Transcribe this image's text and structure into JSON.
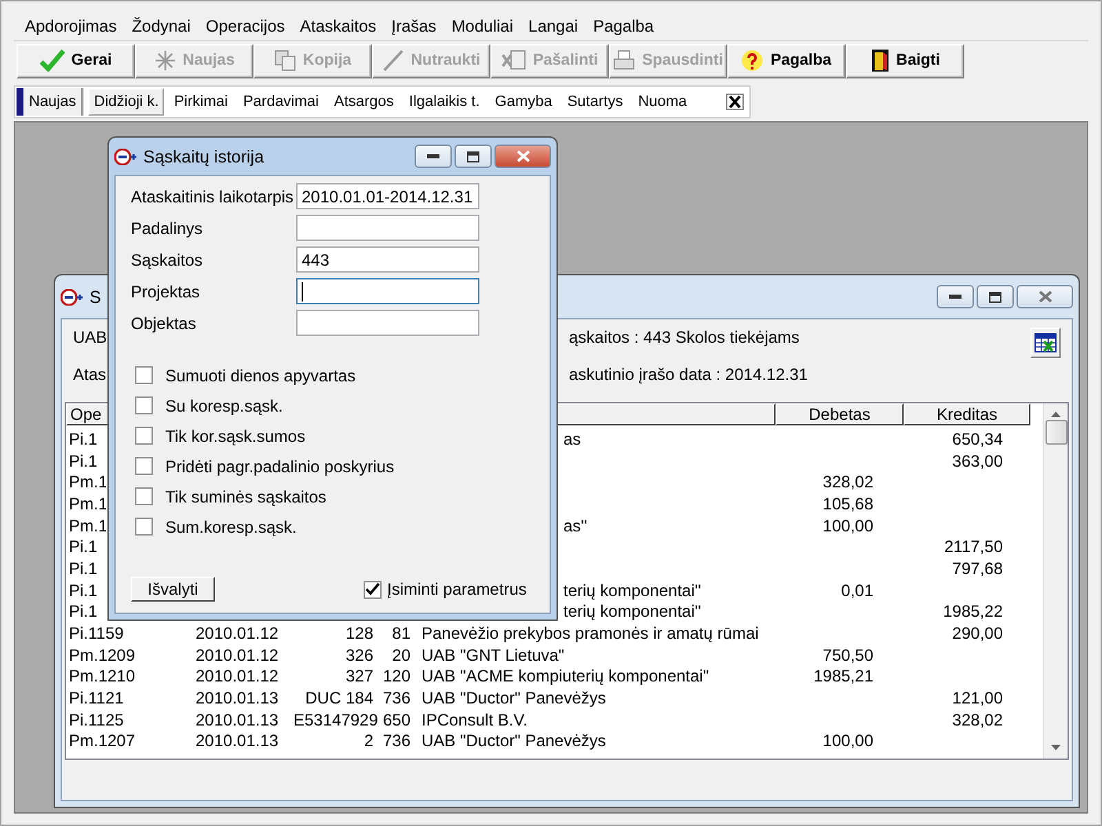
{
  "menu": [
    "Apdorojimas",
    "Žodynai",
    "Operacijos",
    "Ataskaitos",
    "Įrašas",
    "Moduliai",
    "Langai",
    "Pagalba"
  ],
  "toolbar": [
    {
      "label": "Gerai",
      "kind": "ok",
      "disabled": false
    },
    {
      "label": "Naujas",
      "kind": "new",
      "disabled": true
    },
    {
      "label": "Kopija",
      "kind": "copy",
      "disabled": true
    },
    {
      "label": "Nutraukti",
      "kind": "cancel",
      "disabled": true
    },
    {
      "label": "Pašalinti",
      "kind": "delete",
      "disabled": true
    },
    {
      "label": "Spausdinti",
      "kind": "print",
      "disabled": true
    },
    {
      "label": "Pagalba",
      "kind": "help",
      "disabled": false
    },
    {
      "label": "Baigti",
      "kind": "exit",
      "disabled": false
    }
  ],
  "tab_strip": {
    "lead": "Naujas",
    "tabs": [
      {
        "label": "Didžioji k.",
        "selected": true
      },
      {
        "label": "Pirkimai",
        "selected": false
      },
      {
        "label": "Pardavimai",
        "selected": false
      },
      {
        "label": "Atsargos",
        "selected": false
      },
      {
        "label": "Ilgalaikis t.",
        "selected": false
      },
      {
        "label": "Gamyba",
        "selected": false
      },
      {
        "label": "Sutartys",
        "selected": false
      },
      {
        "label": "Nuoma",
        "selected": false
      }
    ]
  },
  "back_window": {
    "title": "S",
    "info": [
      {
        "left": "UAB",
        "right": "ąskaitos : 443  Skolos tiekėjams"
      },
      {
        "left": "Atas",
        "right": "askutinio įrašo data : 2014.12.31"
      }
    ],
    "columns": [
      "Ope",
      "Debetas",
      "Kreditas"
    ],
    "rows": [
      {
        "kind": "partial",
        "op": "Pi.1",
        "name": "as",
        "credit": "650,34"
      },
      {
        "kind": "partial",
        "op": "Pi.1",
        "credit": "363,00"
      },
      {
        "kind": "partial",
        "op": "Pm.1",
        "debit": "328,02"
      },
      {
        "kind": "partial",
        "op": "Pm.1",
        "debit": "105,68"
      },
      {
        "kind": "partial",
        "op": "Pm.1",
        "name": "as''",
        "debit": "100,00"
      },
      {
        "kind": "partial",
        "op": "Pi.1",
        "credit": "2117,50"
      },
      {
        "kind": "partial",
        "op": "Pi.1",
        "credit": "797,68"
      },
      {
        "kind": "partial",
        "op": "Pi.1",
        "name": "terių komponentai''",
        "debit": "0,01"
      },
      {
        "kind": "partial",
        "op": "Pi.1",
        "name": "terių komponentai''",
        "credit": "1985,22"
      },
      {
        "kind": "full",
        "op": "Pi.1159",
        "date": "2010.01.12",
        "doc": "128",
        "code": "81",
        "name": "Panevėžio prekybos pramonės ir amatų rūmai",
        "credit": "290,00"
      },
      {
        "kind": "full",
        "op": "Pm.1209",
        "date": "2010.01.12",
        "doc": "326",
        "code": "20",
        "name": "UAB \"GNT Lietuva\"",
        "debit": "750,50"
      },
      {
        "kind": "full",
        "op": "Pm.1210",
        "date": "2010.01.12",
        "doc": "327",
        "code": "120",
        "name": "UAB \"ACME kompiuterių komponentai\"",
        "debit": "1985,21"
      },
      {
        "kind": "full",
        "op": "Pi.1121",
        "date": "2010.01.13",
        "doc": "DUC 184",
        "code": "736",
        "name": "UAB \"Ductor\" Panevėžys",
        "credit": "121,00"
      },
      {
        "kind": "full",
        "op": "Pi.1125",
        "date": "2010.01.13",
        "doc": "E53147929",
        "code": "650",
        "name": "IPConsult B.V.",
        "credit": "328,02"
      },
      {
        "kind": "full",
        "op": "Pm.1207",
        "date": "2010.01.13",
        "doc": "2",
        "code": "736",
        "name": "UAB \"Ductor\" Panevėžys",
        "debit": "100,00"
      }
    ]
  },
  "dialog": {
    "title": "Sąskaitų istorija",
    "fields": [
      {
        "label": "Ataskaitinis laikotarpis",
        "value": "2010.01.01-2014.12.31",
        "focused": false
      },
      {
        "label": "Padalinys",
        "focused": false
      },
      {
        "label": "Sąskaitos",
        "value": "443",
        "focused": false
      },
      {
        "label": "Projektas",
        "focused": true
      },
      {
        "label": "Objektas",
        "focused": false
      }
    ],
    "option_groups": [
      [
        {
          "label": "Sumuoti dienos apyvartas",
          "checked": false
        },
        {
          "label": "Su koresp.sąsk.",
          "checked": false
        },
        {
          "label": "Tik kor.sąsk.sumos",
          "checked": false
        },
        {
          "label": "Pridėti  pagr.padalinio poskyrius",
          "checked": false
        }
      ],
      [
        {
          "label": "Tik suminės sąskaitos",
          "checked": false
        },
        {
          "label": "Sum.koresp.sąsk.",
          "checked": false
        }
      ]
    ],
    "clear_button": "Išvalyti",
    "remember": {
      "label": "Įsiminti parametrus",
      "checked": true
    }
  }
}
